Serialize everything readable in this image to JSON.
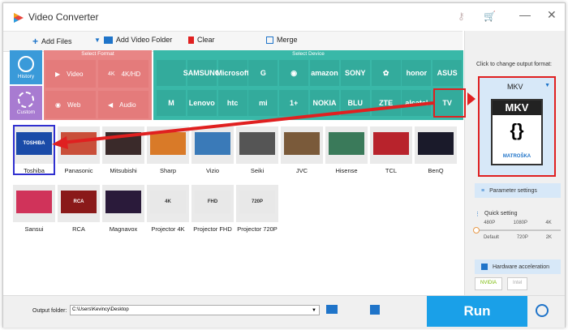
{
  "window": {
    "title": "Video Converter"
  },
  "toolbar": {
    "add_files": "Add Files",
    "add_video_folder": "Add Video Folder",
    "clear": "Clear",
    "merge": "Merge"
  },
  "sidebar": {
    "history": "History",
    "custom": "Custom"
  },
  "formats": {
    "header": "Select Format",
    "items": [
      "Video",
      "4K/HD",
      "Web",
      "Audio"
    ]
  },
  "devices": {
    "header": "Select Device",
    "brands_row1": [
      "",
      "SAMSUNG",
      "Microsoft",
      "G",
      "",
      "amazon",
      "SONY",
      "",
      "honor",
      "ASUS"
    ],
    "brands_row2": [
      "",
      "Lenovo",
      "htc",
      "mi",
      "",
      "NOKIA",
      "BLU",
      "ZTE",
      "alcatel",
      "TV"
    ]
  },
  "device_list": [
    {
      "name": "Toshiba",
      "thumb": "TOSHIBA"
    },
    {
      "name": "Panasonic",
      "thumb": ""
    },
    {
      "name": "Mitsubishi",
      "thumb": ""
    },
    {
      "name": "Sharp",
      "thumb": ""
    },
    {
      "name": "Vizio",
      "thumb": ""
    },
    {
      "name": "Seiki",
      "thumb": ""
    },
    {
      "name": "JVC",
      "thumb": ""
    },
    {
      "name": "Hisense",
      "thumb": ""
    },
    {
      "name": "TCL",
      "thumb": ""
    },
    {
      "name": "BenQ",
      "thumb": ""
    },
    {
      "name": "Sansui",
      "thumb": ""
    },
    {
      "name": "RCA",
      "thumb": "RCA"
    },
    {
      "name": "Magnavox",
      "thumb": ""
    },
    {
      "name": "Projector 4K",
      "thumb": "4K"
    },
    {
      "name": "Projector FHD",
      "thumb": "FHD"
    },
    {
      "name": "Projector 720P",
      "thumb": "720P"
    }
  ],
  "output": {
    "click_text": "Click to change output format:",
    "format": "MKV",
    "badge_top": "MKV",
    "badge_bottom": "MATROŠKA",
    "param_settings": "Parameter settings",
    "quick_setting": "Quick setting",
    "quality_top": [
      "480P",
      "1080P",
      "4K"
    ],
    "quality_bottom": [
      "Default",
      "720P",
      "2K"
    ],
    "hardware_acceleration": "Hardware acceleration",
    "gpu1": "NVIDIA",
    "gpu2": "Intel"
  },
  "bottom": {
    "output_folder_label": "Output folder:",
    "output_folder_value": "C:\\Users\\Kevincy\\Desktop",
    "run": "Run"
  },
  "colors": {
    "accent": "#1aa0e8",
    "format": "#e88585",
    "device": "#39b8a8",
    "highlight": "#e02020"
  }
}
